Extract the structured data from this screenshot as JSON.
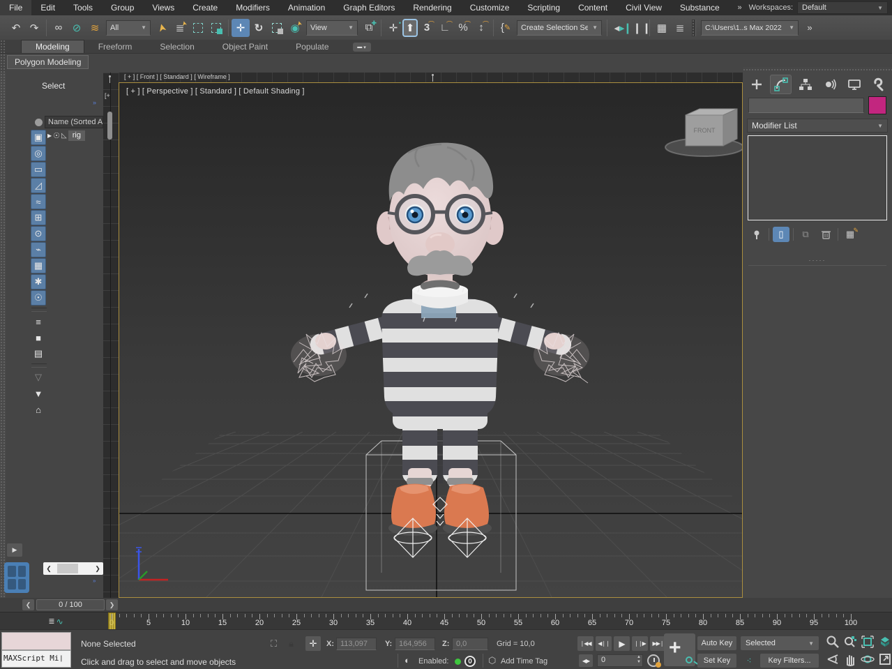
{
  "menubar": {
    "items": [
      "File",
      "Edit",
      "Tools",
      "Group",
      "Views",
      "Create",
      "Modifiers",
      "Animation",
      "Graph Editors",
      "Rendering",
      "Customize",
      "Scripting",
      "Content",
      "Civil View",
      "Substance"
    ],
    "overflow": "»",
    "workspaces_label": "Workspaces:",
    "workspaces_value": "Default"
  },
  "toolbar": {
    "filter_value": "All",
    "coord_value": "View",
    "selection_set": "Create Selection Se",
    "project": "C:\\Users\\1..s Max 2022",
    "overflow": "»"
  },
  "ribbon": {
    "tabs": [
      {
        "label": "Modeling",
        "active": true
      },
      {
        "label": "Freeform"
      },
      {
        "label": "Selection"
      },
      {
        "label": "Object Paint"
      },
      {
        "label": "Populate"
      }
    ],
    "subtab": "Polygon Modeling"
  },
  "explorer": {
    "title": "Select",
    "name_header": "Name (Sorted A",
    "expand_glyph": "»",
    "rows": [
      {
        "label": "rig",
        "expand": "▶",
        "eye": "☉",
        "pick": "◺"
      }
    ],
    "filters": [
      {
        "name": "filter-display-geometry-icon",
        "glyph": "▣",
        "active": true
      },
      {
        "name": "filter-display-lights-icon",
        "glyph": "◎",
        "active": true
      },
      {
        "name": "filter-display-cameras-icon",
        "glyph": "▭",
        "active": true
      },
      {
        "name": "filter-display-helpers-icon",
        "glyph": "◿",
        "active": true
      },
      {
        "name": "filter-display-spacewarps-icon",
        "glyph": "≈",
        "active": true
      },
      {
        "name": "filter-display-groups-icon",
        "glyph": "⊞",
        "active": true
      },
      {
        "name": "filter-display-xrefs-icon",
        "glyph": "⊙",
        "active": true
      },
      {
        "name": "filter-display-bones-icon",
        "glyph": "⌁",
        "active": true
      },
      {
        "name": "filter-display-containers-icon",
        "glyph": "▦",
        "active": true
      },
      {
        "name": "filter-display-particles-icon",
        "glyph": "✱",
        "active": true
      },
      {
        "name": "filter-display-frozen-icon",
        "glyph": "☉",
        "active": true
      },
      {
        "name": "separator",
        "sep": true
      },
      {
        "name": "explorer-list-view-icon",
        "glyph": "≡"
      },
      {
        "name": "explorer-block-view-icon",
        "glyph": "■"
      },
      {
        "name": "explorer-detail-view-icon",
        "glyph": "▤"
      },
      {
        "name": "separator",
        "sep": true
      },
      {
        "name": "explorer-filter-off-icon",
        "glyph": "▽",
        "dim": true
      },
      {
        "name": "explorer-filter-icon",
        "glyph": "▼"
      },
      {
        "name": "explorer-archive-icon",
        "glyph": "⌂"
      }
    ]
  },
  "viewport": {
    "label": "[ + ] [ Perspective ] [ Standard ] [ Default Shading ]",
    "front_label": "[ + ] [ Front ] [ Standard ] [ Wireframe ]",
    "left_label": "[+",
    "viewcube": "FRONT"
  },
  "command_panel": {
    "modifier_list": "Modifier List"
  },
  "time": {
    "slider_value": "0 / 100",
    "frame_value": "0",
    "start": 0,
    "end": 100,
    "label_step": 5
  },
  "statusbar": {
    "maxscript": "MAXScript Mi",
    "selection_status": "None Selected",
    "prompt": "Click and drag to select and move objects",
    "x_label": "X:",
    "x_value": "113,097",
    "y_label": "Y:",
    "y_value": "164,956",
    "z_label": "Z:",
    "z_value": "0,0",
    "grid_label": "Grid = 10,0",
    "enabled_label": "Enabled:",
    "enabled_count": "0",
    "add_time_tag": "Add Time Tag",
    "auto_key": "Auto Key",
    "set_key": "Set Key",
    "key_mode_value": "Selected",
    "key_filters": "Key Filters..."
  }
}
